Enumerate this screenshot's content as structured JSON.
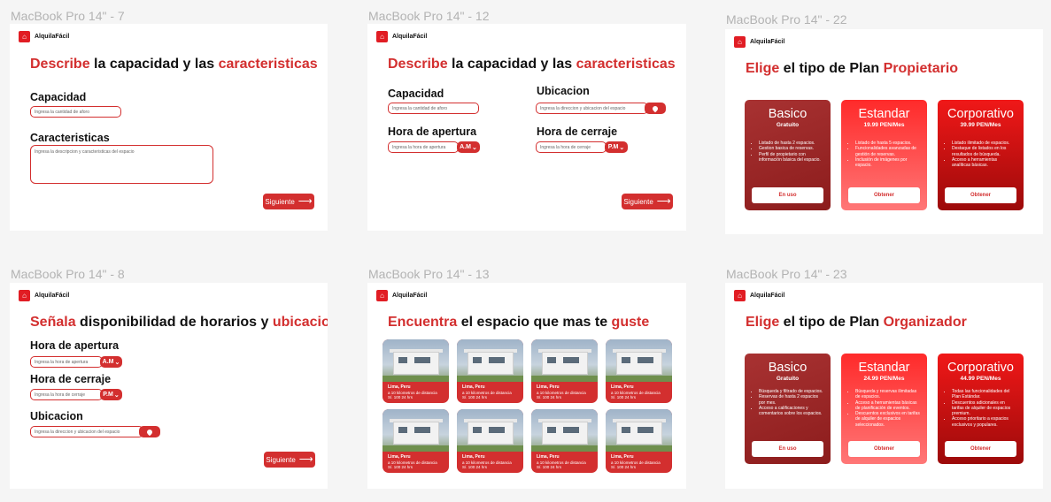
{
  "brand": "AlquilaFácil",
  "labels": {
    "f7": "MacBook Pro 14\" - 7",
    "f12": "MacBook Pro 14\" - 12",
    "f22": "MacBook Pro 14\" - 22",
    "f8": "MacBook Pro 14\" - 8",
    "f13": "MacBook Pro 14\" - 13",
    "f23": "MacBook Pro 14\" - 23"
  },
  "common": {
    "next": "Siguiente",
    "capacidad": "Capacidad",
    "caracteristicas": "Caracteristicas",
    "ubicacion": "Ubicacion",
    "apertura": "Hora de apertura",
    "cierre": "Hora de cerraje",
    "ph_aforo": "Ingresa la cantidad de aforo",
    "ph_desc": "Ingresa la descripcion y caracteristicas del espacio",
    "ph_dir": "Ingresa la direccion y ubicacion del espacio",
    "ph_apertura": "Ingresa la hora de apertura",
    "ph_cierre": "Ingresa la hora de cerraje",
    "am": "A.M",
    "pm": "P.M"
  },
  "f7": {
    "t1": "Describe",
    "t2": " la capacidad y las ",
    "t3": "caracteristicas"
  },
  "f8": {
    "t1": "Señala",
    "t2": " disponibilidad de horarios y ",
    "t3": "ubicacion"
  },
  "f13": {
    "t1": "Encuentra",
    "t2": " el espacio que mas te ",
    "t3": "guste",
    "card_city": "Lima, Peru",
    "card_dist": "a 10 kilometros de distancia",
    "card_price": "S/. 100 24 hrs"
  },
  "f22": {
    "t1": "Elige",
    "t2": " el tipo de Plan ",
    "t3": "Propietario",
    "plans": [
      {
        "name": "Basico",
        "price": "Gratuito",
        "btn": "En uso",
        "features": [
          "Listado de hasta 2 espacios.",
          "Gestion basica de reservas.",
          "Perfil de propietario con información básica del espacio."
        ]
      },
      {
        "name": "Estandar",
        "price": "19.99 PEN/Mes",
        "btn": "Obtener",
        "features": [
          "Listado de hasta 5 espacios.",
          "Funcionalidades avanzadas de gestión de reservas.",
          "Inclusión de imágenes por espacio."
        ]
      },
      {
        "name": "Corporativo",
        "price": "39.99 PEN/Mes",
        "btn": "Obtener",
        "features": [
          "Listado ilimitado de espacios.",
          "Destaque de listados en los resultados de búsqueda.",
          "Acceso a herramientas analíticas básicas."
        ]
      }
    ]
  },
  "f23": {
    "t1": "Elige",
    "t2": " el tipo de Plan ",
    "t3": "Organizador",
    "plans": [
      {
        "name": "Basico",
        "price": "Gratuito",
        "btn": "En uso",
        "features": [
          "Búsqueda y filtrado de espacios.",
          "Reservas de hasta 2 espacios por mes.",
          "Acceso a calificaciones y comentarios sobre los espacios."
        ]
      },
      {
        "name": "Estandar",
        "price": "24.99 PEN/Mes",
        "btn": "Obtener",
        "features": [
          "Búsqueda y reservas ilimitadas de espacios.",
          "Acceso a herramientas básicas de planificación de eventos.",
          "Descuentos exclusivos en tarifas de alquiler de espacios seleccionados."
        ]
      },
      {
        "name": "Corporativo",
        "price": "44.99 PEN/Mes",
        "btn": "Obtener",
        "features": [
          "Todas las funcionalidades del Plan Estándar.",
          "Descuentos adicionales en tarifas de alquiler de espacios premium.",
          "Acceso prioritario a espacios exclusivos y populares."
        ]
      }
    ]
  }
}
